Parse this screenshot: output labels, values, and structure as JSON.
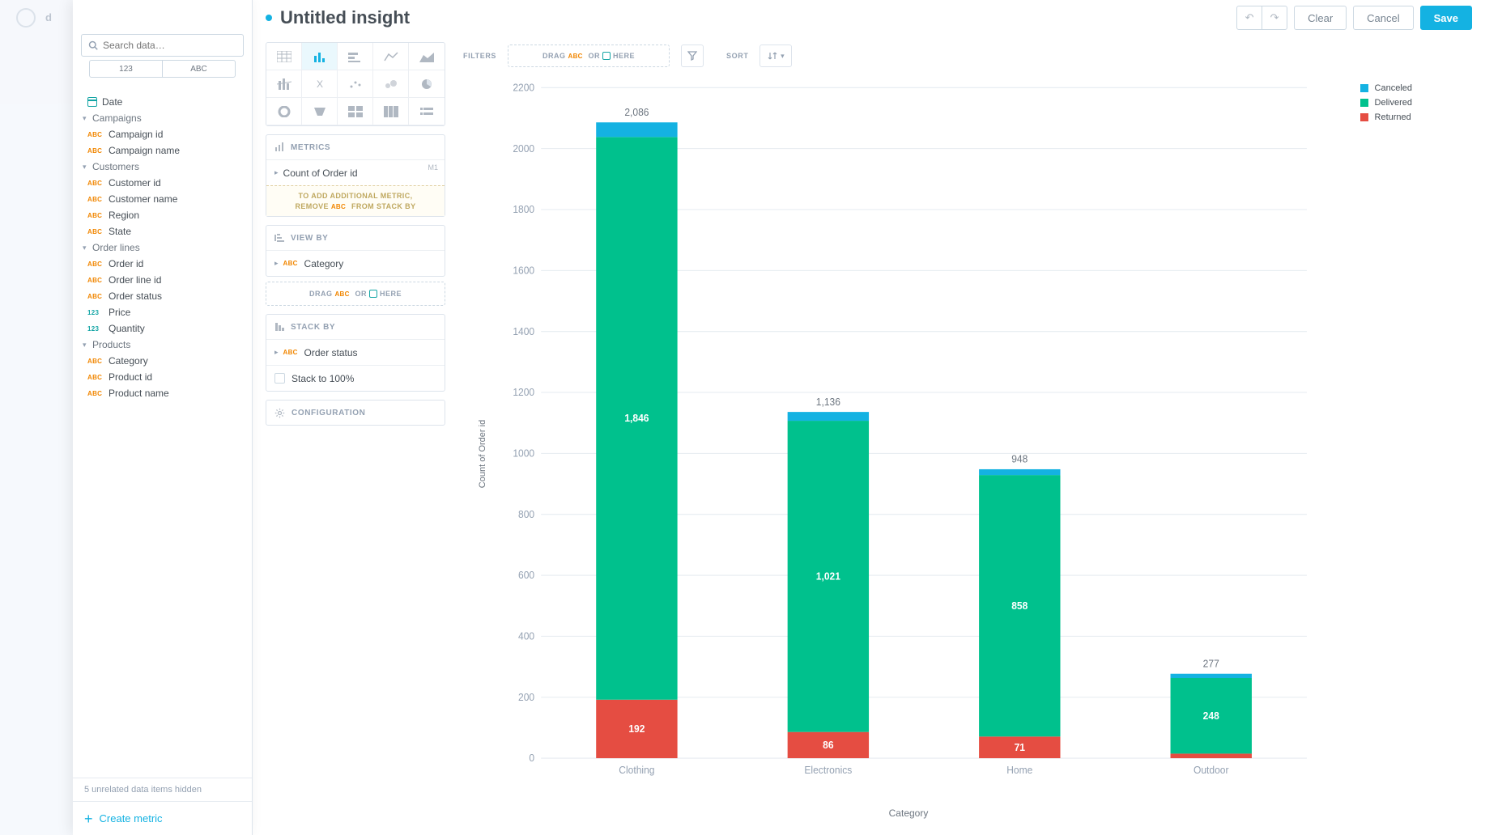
{
  "header": {
    "title": "Untitled insight",
    "undo": "↶",
    "redo": "↷",
    "clear": "Clear",
    "cancel": "Cancel",
    "save": "Save"
  },
  "catalog": {
    "search_placeholder": "Search data…",
    "tab_measures": "123",
    "tab_attributes": "ABC",
    "date_label": "Date",
    "groups": [
      {
        "name": "Campaigns",
        "items": [
          {
            "type": "abc",
            "label": "Campaign id"
          },
          {
            "type": "abc",
            "label": "Campaign name"
          }
        ]
      },
      {
        "name": "Customers",
        "items": [
          {
            "type": "abc",
            "label": "Customer id"
          },
          {
            "type": "abc",
            "label": "Customer name"
          },
          {
            "type": "abc",
            "label": "Region"
          },
          {
            "type": "abc",
            "label": "State"
          }
        ]
      },
      {
        "name": "Order lines",
        "items": [
          {
            "type": "abc",
            "label": "Order id"
          },
          {
            "type": "abc",
            "label": "Order line id"
          },
          {
            "type": "abc",
            "label": "Order status"
          },
          {
            "type": "num",
            "label": "Price"
          },
          {
            "type": "num",
            "label": "Quantity"
          }
        ]
      },
      {
        "name": "Products",
        "items": [
          {
            "type": "abc",
            "label": "Category"
          },
          {
            "type": "abc",
            "label": "Product id"
          },
          {
            "type": "abc",
            "label": "Product name"
          }
        ]
      }
    ],
    "footer": "5 unrelated data items hidden",
    "create_metric": "Create metric"
  },
  "buckets": {
    "metrics_label": "METRICS",
    "metric_item": "Count of Order id",
    "metric_badge": "M1",
    "metric_note_1": "TO ADD ADDITIONAL METRIC,",
    "metric_note_2a": "REMOVE",
    "metric_note_2b": "FROM STACK BY",
    "viewby_label": "VIEW BY",
    "viewby_item": "Category",
    "drop_drag": "DRAG",
    "drop_or": "OR",
    "drop_here": "HERE",
    "stackby_label": "STACK BY",
    "stackby_item": "Order status",
    "stack_to_100": "Stack to 100%",
    "configuration": "CONFIGURATION"
  },
  "toolbar": {
    "filters": "FILTERS",
    "sort": "SORT"
  },
  "legend": {
    "items": [
      {
        "color": "#14b2e2",
        "label": "Canceled"
      },
      {
        "color": "#00c18d",
        "label": "Delivered"
      },
      {
        "color": "#e54d42",
        "label": "Returned"
      }
    ]
  },
  "axes": {
    "y_label": "Count of Order id",
    "x_label": "Category"
  },
  "chart_data": {
    "type": "bar",
    "stacked": true,
    "categories": [
      "Clothing",
      "Electronics",
      "Home",
      "Outdoor"
    ],
    "series": [
      {
        "name": "Returned",
        "color": "#e54d42",
        "values": [
          192,
          86,
          71,
          15
        ]
      },
      {
        "name": "Delivered",
        "color": "#00c18d",
        "values": [
          1846,
          1021,
          858,
          248
        ]
      },
      {
        "name": "Canceled",
        "color": "#14b2e2",
        "values": [
          48,
          29,
          19,
          14
        ]
      }
    ],
    "totals": [
      2086,
      1136,
      948,
      277
    ],
    "ylim": [
      0,
      2200
    ],
    "ytick": 200,
    "xlabel": "Category",
    "ylabel": "Count of Order id",
    "data_labels_visible": {
      "Returned": [
        true,
        true,
        true,
        false
      ],
      "Delivered": [
        true,
        true,
        true,
        true
      ],
      "Canceled": [
        false,
        false,
        false,
        false
      ]
    }
  }
}
